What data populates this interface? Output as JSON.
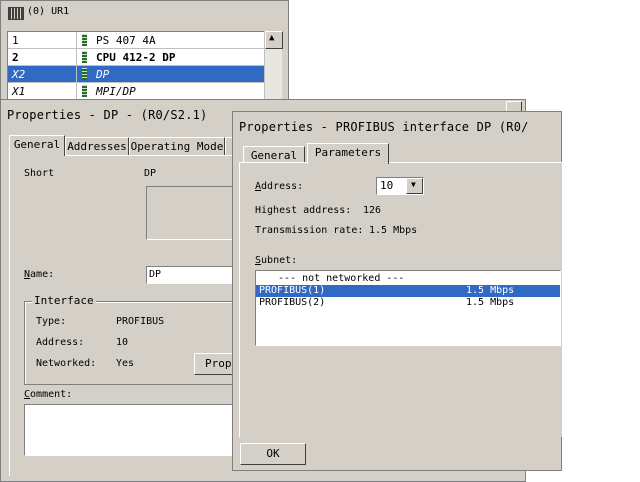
{
  "rack": {
    "title": "(0) UR1",
    "rows": [
      {
        "slot": "1",
        "module": "PS 407 4A",
        "style": "normal",
        "selected": false
      },
      {
        "slot": "2",
        "module": "CPU 412-2 DP",
        "style": "bold",
        "selected": false
      },
      {
        "slot": "X2",
        "module": "DP",
        "style": "italic",
        "selected": true
      },
      {
        "slot": "X1",
        "module": "MPI/DP",
        "style": "italic",
        "selected": false
      }
    ]
  },
  "dp_dialog": {
    "title": "Properties - DP - (R0/S2.1)",
    "tabs": [
      "General",
      "Addresses",
      "Operating Mode",
      "Co"
    ],
    "short_label": "Short",
    "short_value": "DP",
    "name_label": "Name:",
    "name_value": "DP",
    "interface_group": "Interface",
    "type_label": "Type:",
    "type_value": "PROFIBUS",
    "address_label": "Address:",
    "address_value": "10",
    "networked_label": "Networked:",
    "networked_value": "Yes",
    "properties_button": "Prope",
    "comment_label": "Comment:"
  },
  "profibus_dialog": {
    "title": "Properties - PROFIBUS interface  DP (R0/",
    "tabs": [
      "General",
      "Parameters"
    ],
    "active_tab": "Parameters",
    "address_label": "Address:",
    "address_value": "10",
    "highest_address_label": "Highest address:",
    "highest_address_value": "126",
    "transmission_rate_label": "Transmission rate:",
    "transmission_rate_value": "1.5 Mbps",
    "subnet_label": "Subnet:",
    "subnets": [
      {
        "name": "--- not networked ---",
        "rate": "",
        "selected": false
      },
      {
        "name": "PROFIBUS(1)",
        "rate": "1.5 Mbps",
        "selected": true
      },
      {
        "name": "PROFIBUS(2)",
        "rate": "1.5 Mbps",
        "selected": false
      }
    ],
    "ok_button": "OK"
  },
  "colors": {
    "dialog_face": "#d4d0c8",
    "selection": "#316ac5"
  }
}
